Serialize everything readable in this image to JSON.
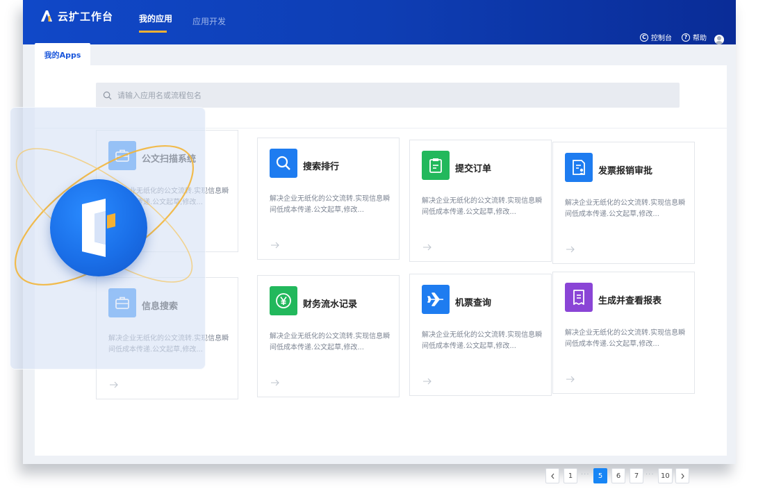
{
  "header": {
    "brand": "云扩工作台",
    "tabs": [
      {
        "label": "我的应用",
        "active": true
      },
      {
        "label": "应用开发",
        "active": false
      }
    ],
    "console_label": "控制台",
    "help_label": "帮助"
  },
  "page_tab": "我的Apps",
  "search": {
    "placeholder": "请输入应用名或流程包名"
  },
  "cards": [
    {
      "title": "公文扫描系统",
      "desc": "解决企业无纸化的公文流转.实现信息瞬间低成本传递.公文起草,修改...",
      "icon": "briefcase-icon",
      "color": "#2f8cf6"
    },
    {
      "title": "搜索排行",
      "desc": "解决企业无纸化的公文流转.实现信息瞬间低成本传递.公文起草,修改...",
      "icon": "search-icon",
      "color": "#1e7cf0"
    },
    {
      "title": "提交订单",
      "desc": "解决企业无纸化的公文流转.实现信息瞬间低成本传递.公文起草,修改...",
      "icon": "clipboard-icon",
      "color": "#22b85c"
    },
    {
      "title": "发票报销审批",
      "desc": "解决企业无纸化的公文流转.实现信息瞬间低成本传递.公文起草,修改...",
      "icon": "invoice-icon",
      "color": "#1e7cf0"
    },
    {
      "title": "信息搜索",
      "desc": "解决企业无纸化的公文流转.实现信息瞬间低成本传递.公文起草,修改...",
      "icon": "briefcase-icon",
      "color": "#2f8cf6"
    },
    {
      "title": "财务流水记录",
      "desc": "解决企业无纸化的公文流转.实现信息瞬间低成本传递.公文起草,修改...",
      "icon": "yen-icon",
      "color": "#22b85c"
    },
    {
      "title": "机票查询",
      "desc": "解决企业无纸化的公文流转.实现信息瞬间低成本传递.公文起草,修改...",
      "icon": "airplane-icon",
      "color": "#1e7cf0"
    },
    {
      "title": "生成并查看报表",
      "desc": "解决企业无纸化的公文流转.实现信息瞬间低成本传递.公文起草,修改...",
      "icon": "report-icon",
      "color": "#8a45d6"
    }
  ],
  "pagination": {
    "pages": [
      "1",
      "5",
      "6",
      "7",
      "10"
    ],
    "current": "5",
    "ellipsis": "···"
  },
  "colors": {
    "header": "#0e3eb4",
    "accent": "#1785f5",
    "nav_underline": "#f5b133",
    "logo_circle": "#1a6fe8",
    "logo_accent": "#f5b133"
  }
}
